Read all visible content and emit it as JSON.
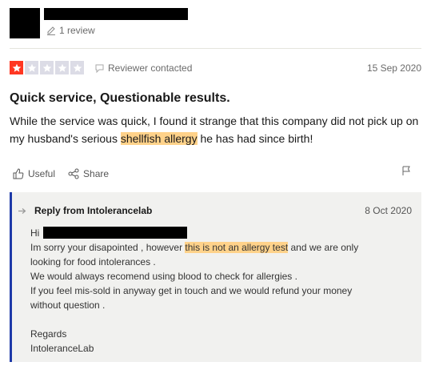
{
  "reviewer": {
    "review_count": "1 review"
  },
  "review": {
    "rating": 1,
    "rating_max": 5,
    "contact_status": "Reviewer contacted",
    "date": "15 Sep 2020",
    "title": "Quick service, Questionable results.",
    "body_before": "While the service was quick, I found it strange that this company did not pick up on my husband's serious ",
    "body_highlight": "shellfish allergy",
    "body_after": " he has had since birth!"
  },
  "actions": {
    "useful_label": "Useful",
    "share_label": "Share"
  },
  "reply": {
    "heading": "Reply from Intolerancelab",
    "date": "8 Oct 2020",
    "greeting": "Hi",
    "line1_before": "Im sorry your disapointed , however ",
    "line1_highlight": "this is not an allergy test",
    "line1_after": " and we are only",
    "line2": "looking for food intolerances .",
    "line3": "We would always recomend using blood to check for allergies .",
    "line4": "If you feel mis-sold in anyway get in touch and we would refund your money",
    "line5": "without question .",
    "signoff": "Regards",
    "company": "IntoleranceLab"
  },
  "colors": {
    "star_active": "#ff3722",
    "star_inactive": "#dcdce6",
    "highlight": "#ffd28a",
    "reply_border": "#1e3aa8",
    "reply_bg": "#f1f1ef"
  },
  "icons": [
    "pencil-icon",
    "star-icon",
    "chat-icon",
    "thumbs-up-icon",
    "share-icon",
    "flag-icon",
    "reply-arrow-icon"
  ]
}
